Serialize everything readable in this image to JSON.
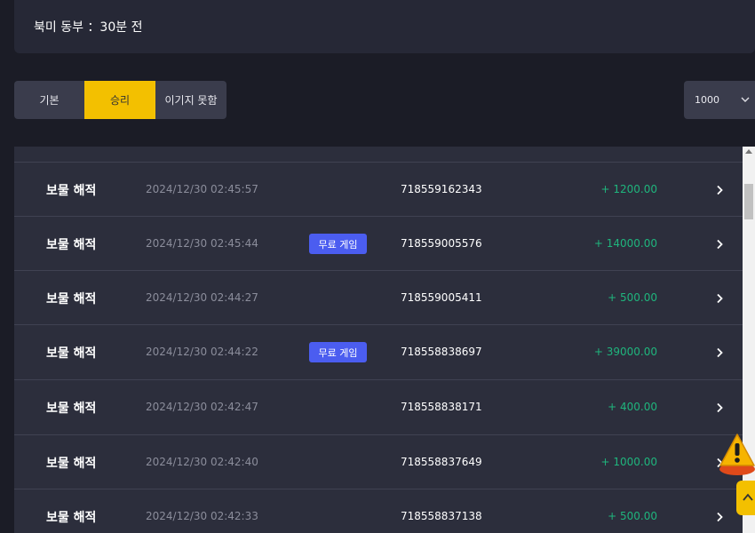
{
  "header": {
    "status_text": "북미 동부 ：30분 전"
  },
  "tabs": [
    {
      "label": "기본",
      "active": false
    },
    {
      "label": "승리",
      "active": true
    },
    {
      "label": "이기지 못함",
      "active": false
    }
  ],
  "page_size": {
    "selected": "1000",
    "icon": "chevron-down-icon"
  },
  "rows": [
    {
      "title": "보물 해적",
      "time": "2024/12/30 02:45:57",
      "badge": "",
      "id": "718559162343",
      "amount": "+ 1200.00"
    },
    {
      "title": "보물 해적",
      "time": "2024/12/30 02:45:44",
      "badge": "무료 게임",
      "id": "718559005576",
      "amount": "+ 14000.00"
    },
    {
      "title": "보물 해적",
      "time": "2024/12/30 02:44:27",
      "badge": "",
      "id": "718559005411",
      "amount": "+ 500.00"
    },
    {
      "title": "보물 해적",
      "time": "2024/12/30 02:44:22",
      "badge": "무료 게임",
      "id": "718558838697",
      "amount": "+ 39000.00"
    },
    {
      "title": "보물 해적",
      "time": "2024/12/30 02:42:47",
      "badge": "",
      "id": "718558838171",
      "amount": "+ 400.00"
    },
    {
      "title": "보물 해적",
      "time": "2024/12/30 02:42:40",
      "badge": "",
      "id": "718558837649",
      "amount": "+ 1000.00"
    },
    {
      "title": "보물 해적",
      "time": "2024/12/30 02:42:33",
      "badge": "",
      "id": "718558837138",
      "amount": "+ 500.00"
    }
  ],
  "colors": {
    "background": "#1b1c26",
    "panel": "#2c2e3c",
    "accent": "#f3c000",
    "badge": "#4b5df0",
    "win_amount": "#1fb57d",
    "muted_text": "#8b8d9b"
  },
  "floating": {
    "warning_icon": "warning-icon",
    "scroll_top_icon": "chevron-up-icon"
  }
}
